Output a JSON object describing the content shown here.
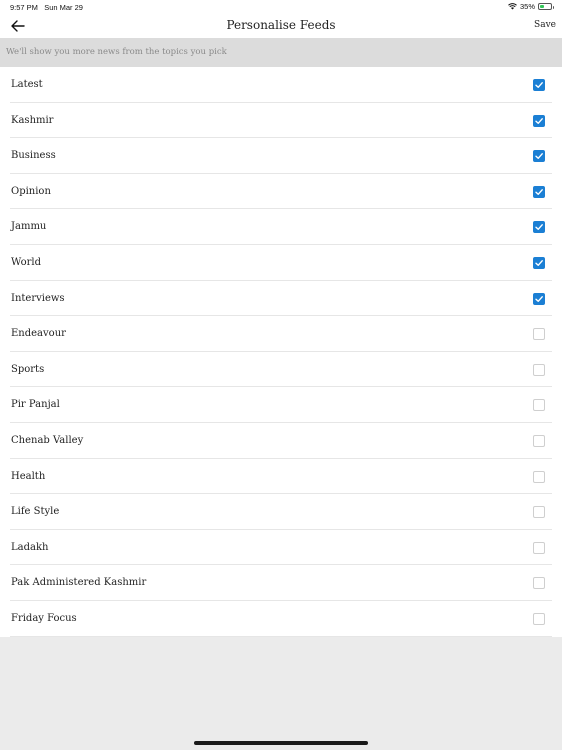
{
  "status_bar": {
    "time": "9:57 PM",
    "date": "Sun Mar 29",
    "battery_percent": "35%",
    "battery_level": 0.35,
    "wifi_icon": "wifi-icon",
    "battery_icon": "battery-charging-icon"
  },
  "nav": {
    "back_icon": "arrow-left-icon",
    "title": "Personalise Feeds",
    "save_label": "Save"
  },
  "subtitle": "We'll show you more news from the topics you pick",
  "colors": {
    "checkbox_checked": "#1b7fd4",
    "subtitle_bg": "#dcdcdc",
    "page_bg": "#ebebeb"
  },
  "topics": [
    {
      "label": "Latest",
      "checked": true
    },
    {
      "label": "Kashmir",
      "checked": true
    },
    {
      "label": "Business",
      "checked": true
    },
    {
      "label": "Opinion",
      "checked": true
    },
    {
      "label": "Jammu",
      "checked": true
    },
    {
      "label": "World",
      "checked": true
    },
    {
      "label": "Interviews",
      "checked": true
    },
    {
      "label": "Endeavour",
      "checked": false
    },
    {
      "label": "Sports",
      "checked": false
    },
    {
      "label": "Pir Panjal",
      "checked": false
    },
    {
      "label": "Chenab Valley",
      "checked": false
    },
    {
      "label": "Health",
      "checked": false
    },
    {
      "label": "Life Style",
      "checked": false
    },
    {
      "label": "Ladakh",
      "checked": false
    },
    {
      "label": "Pak Administered Kashmir",
      "checked": false
    },
    {
      "label": "Friday Focus",
      "checked": false
    }
  ]
}
